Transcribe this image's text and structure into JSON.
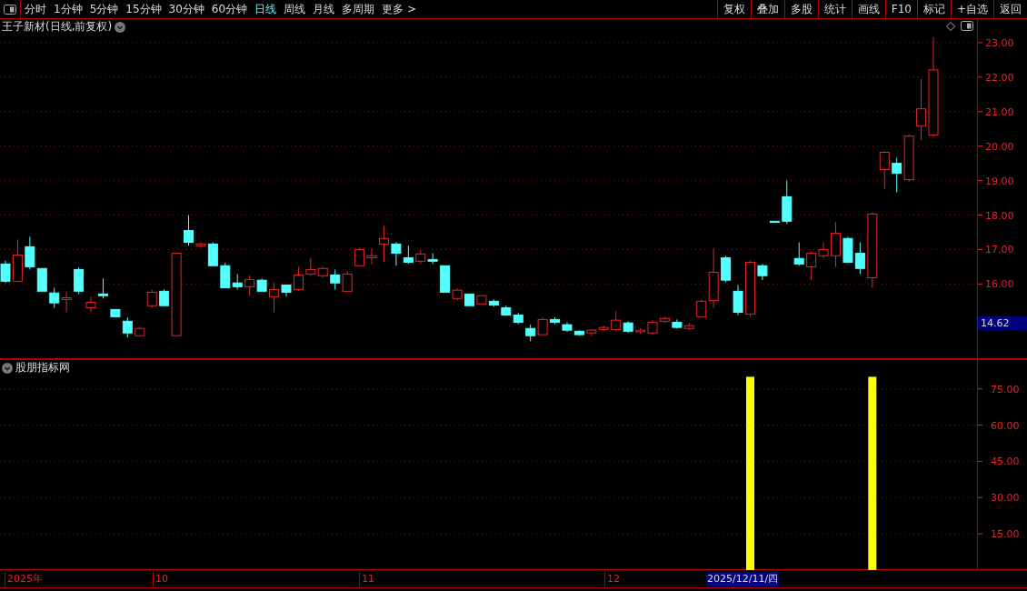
{
  "toolbar": {
    "periods": [
      {
        "label": "分时",
        "selected": false
      },
      {
        "label": "1分钟",
        "selected": false
      },
      {
        "label": "5分钟",
        "selected": false
      },
      {
        "label": "15分钟",
        "selected": false
      },
      {
        "label": "30分钟",
        "selected": false
      },
      {
        "label": "60分钟",
        "selected": false
      },
      {
        "label": "日线",
        "selected": true
      },
      {
        "label": "周线",
        "selected": false
      },
      {
        "label": "月线",
        "selected": false
      },
      {
        "label": "多周期",
        "selected": false
      },
      {
        "label": "更多 >",
        "selected": false
      }
    ],
    "buttons": [
      "复权",
      "叠加",
      "多股",
      "统计",
      "画线",
      "F10",
      "标记",
      "+自选",
      "返回"
    ]
  },
  "price_panel": {
    "title": "王子新材(日线,前复权)",
    "current_price": "14.62",
    "chart_data": {
      "type": "candlestick",
      "grid": true,
      "ylim": [
        13.82,
        23.71
      ],
      "categories": [
        null,
        null,
        null,
        null,
        null,
        null,
        null,
        null,
        null,
        null,
        null,
        null,
        null,
        null,
        null,
        null,
        null,
        null,
        null,
        null,
        null,
        null,
        null,
        null,
        null,
        null,
        null,
        null,
        null,
        null,
        null,
        null,
        null,
        null,
        null,
        null,
        null,
        null,
        null,
        null,
        null,
        null,
        null,
        null,
        null,
        null,
        null,
        null,
        null,
        null,
        null,
        null,
        null,
        null,
        null,
        null,
        null,
        null,
        null,
        null,
        null,
        null,
        null,
        null,
        null,
        null,
        null,
        null,
        null,
        null,
        null,
        null,
        null,
        null,
        null,
        null,
        null
      ],
      "yticks": [
        {
          "value": 23,
          "label": "23.00"
        },
        {
          "value": 22,
          "label": "22.00"
        },
        {
          "value": 21,
          "label": "21.00"
        },
        {
          "value": 20,
          "label": "20.00"
        },
        {
          "value": 19,
          "label": "19.00"
        },
        {
          "value": 18,
          "label": "18.00"
        },
        {
          "value": 17,
          "label": "17.00"
        },
        {
          "value": 16,
          "label": "16.00"
        }
      ],
      "ohlc": [
        [
          16.58,
          16.68,
          16.03,
          16.08
        ],
        [
          16.08,
          17.29,
          16.08,
          16.84
        ],
        [
          17.08,
          17.37,
          16.42,
          16.5
        ],
        [
          16.45,
          16.45,
          15.79,
          15.79
        ],
        [
          15.74,
          15.89,
          15.31,
          15.45
        ],
        [
          15.55,
          15.79,
          15.18,
          15.6
        ],
        [
          16.42,
          16.48,
          15.71,
          15.79
        ],
        [
          15.31,
          15.63,
          15.18,
          15.47
        ],
        [
          15.71,
          16.16,
          15.58,
          15.66
        ],
        [
          15.26,
          15.26,
          15.05,
          15.05
        ],
        [
          14.92,
          15.03,
          14.45,
          14.58
        ],
        [
          14.5,
          14.76,
          14.5,
          14.71
        ],
        [
          15.37,
          15.84,
          15.31,
          15.76
        ],
        [
          15.79,
          15.84,
          15.37,
          15.37
        ],
        [
          14.5,
          16.89,
          14.5,
          16.89
        ],
        [
          17.55,
          18.0,
          17.11,
          17.21
        ],
        [
          17.11,
          17.21,
          17.05,
          17.16
        ],
        [
          17.16,
          17.21,
          16.53,
          16.53
        ],
        [
          16.53,
          16.61,
          15.89,
          15.89
        ],
        [
          16.03,
          16.29,
          15.84,
          15.92
        ],
        [
          15.92,
          16.24,
          15.66,
          16.13
        ],
        [
          16.11,
          16.16,
          15.79,
          15.79
        ],
        [
          15.63,
          16.03,
          15.18,
          15.84
        ],
        [
          15.97,
          15.97,
          15.63,
          15.76
        ],
        [
          15.84,
          16.5,
          15.79,
          16.26
        ],
        [
          16.29,
          16.76,
          16.24,
          16.42
        ],
        [
          16.24,
          16.5,
          16.18,
          16.45
        ],
        [
          16.26,
          16.42,
          15.84,
          16.03
        ],
        [
          15.79,
          16.37,
          15.79,
          16.29
        ],
        [
          16.53,
          17.05,
          16.53,
          17.0
        ],
        [
          16.76,
          17.03,
          16.58,
          16.82
        ],
        [
          17.16,
          17.68,
          16.63,
          17.32
        ],
        [
          17.16,
          17.21,
          16.53,
          16.89
        ],
        [
          16.76,
          17.11,
          16.58,
          16.63
        ],
        [
          16.66,
          17.0,
          16.58,
          16.87
        ],
        [
          16.71,
          16.89,
          16.58,
          16.66
        ],
        [
          16.53,
          16.53,
          15.76,
          15.76
        ],
        [
          15.58,
          15.87,
          15.52,
          15.82
        ],
        [
          15.71,
          15.71,
          15.37,
          15.37
        ],
        [
          15.42,
          15.66,
          15.42,
          15.66
        ],
        [
          15.5,
          15.55,
          15.34,
          15.39
        ],
        [
          15.31,
          15.37,
          15.08,
          15.1
        ],
        [
          15.1,
          15.16,
          14.84,
          14.89
        ],
        [
          14.71,
          14.82,
          14.34,
          14.5
        ],
        [
          14.53,
          15.03,
          14.53,
          14.97
        ],
        [
          14.97,
          15.03,
          14.84,
          14.89
        ],
        [
          14.82,
          14.89,
          14.61,
          14.66
        ],
        [
          14.63,
          14.66,
          14.5,
          14.53
        ],
        [
          14.58,
          14.68,
          14.5,
          14.66
        ],
        [
          14.68,
          14.79,
          14.63,
          14.74
        ],
        [
          14.68,
          15.21,
          14.63,
          14.95
        ],
        [
          14.87,
          14.92,
          14.58,
          14.63
        ],
        [
          14.61,
          14.71,
          14.55,
          14.66
        ],
        [
          14.58,
          14.95,
          14.53,
          14.89
        ],
        [
          14.92,
          15.05,
          14.87,
          15.0
        ],
        [
          14.89,
          14.97,
          14.71,
          14.74
        ],
        [
          14.71,
          14.87,
          14.66,
          14.79
        ],
        [
          15.05,
          15.55,
          15.05,
          15.5
        ],
        [
          15.52,
          17.03,
          15.31,
          16.34
        ],
        [
          16.76,
          16.82,
          16.05,
          16.11
        ],
        [
          15.79,
          15.97,
          15.1,
          15.18
        ],
        [
          15.13,
          16.68,
          15.05,
          16.63
        ],
        [
          16.53,
          16.58,
          16.11,
          16.24
        ],
        [
          17.82,
          17.82,
          17.79,
          17.79
        ],
        [
          18.53,
          19.0,
          17.74,
          17.82
        ],
        [
          16.74,
          17.21,
          16.53,
          16.58
        ],
        [
          16.5,
          16.95,
          16.11,
          16.89
        ],
        [
          16.82,
          17.21,
          16.74,
          17.0
        ],
        [
          16.82,
          17.79,
          16.5,
          17.47
        ],
        [
          17.32,
          17.37,
          16.63,
          16.63
        ],
        [
          16.89,
          17.21,
          16.29,
          16.45
        ],
        [
          16.18,
          18.08,
          15.89,
          18.03
        ],
        [
          19.32,
          19.87,
          18.74,
          19.82
        ],
        [
          19.5,
          19.66,
          18.66,
          19.21
        ],
        [
          19.03,
          20.34,
          18.97,
          20.29
        ],
        [
          20.58,
          21.95,
          20.18,
          21.08
        ],
        [
          20.32,
          23.16,
          20.26,
          22.21
        ]
      ]
    }
  },
  "indicator_panel": {
    "title": "股朋指标网",
    "chart_data": {
      "type": "bar",
      "grid": true,
      "categories": [
        null,
        null,
        null,
        null,
        null,
        null,
        null,
        null,
        null,
        null,
        null,
        null,
        null,
        null,
        null,
        null,
        null,
        null,
        null,
        null,
        null,
        null,
        null,
        null,
        null,
        null,
        null,
        null,
        null,
        null,
        null,
        null,
        null,
        null,
        null,
        null,
        null,
        null,
        null,
        null,
        null,
        null,
        null,
        null,
        null,
        null,
        null,
        null,
        null,
        null,
        null,
        null,
        null,
        null,
        null,
        null,
        null,
        null,
        null,
        null,
        null,
        null,
        null,
        null,
        null,
        null,
        null,
        null,
        null,
        null,
        null,
        null,
        null,
        null,
        null,
        null,
        null
      ],
      "values": [
        0,
        0,
        0,
        0,
        0,
        0,
        0,
        0,
        0,
        0,
        0,
        0,
        0,
        0,
        0,
        0,
        0,
        0,
        0,
        0,
        0,
        0,
        0,
        0,
        0,
        0,
        0,
        0,
        0,
        0,
        0,
        0,
        0,
        0,
        0,
        0,
        0,
        0,
        0,
        0,
        0,
        0,
        0,
        0,
        0,
        0,
        0,
        0,
        0,
        0,
        0,
        0,
        0,
        0,
        0,
        0,
        0,
        0,
        0,
        0,
        0,
        80,
        0,
        0,
        0,
        0,
        0,
        0,
        0,
        0,
        0,
        80,
        0,
        0,
        0,
        0,
        0
      ],
      "ylim": [
        0,
        87.3
      ],
      "yticks": [
        {
          "value": 15,
          "label": "15.00"
        },
        {
          "value": 30,
          "label": "30.00"
        },
        {
          "value": 45,
          "label": "45.00"
        },
        {
          "value": 60,
          "label": "60.00"
        },
        {
          "value": 75,
          "label": "75.00"
        }
      ]
    }
  },
  "date_axis": {
    "labels": [
      "2025年",
      "10",
      "11",
      "12"
    ],
    "cursor_date": "2025/12/11/四"
  }
}
